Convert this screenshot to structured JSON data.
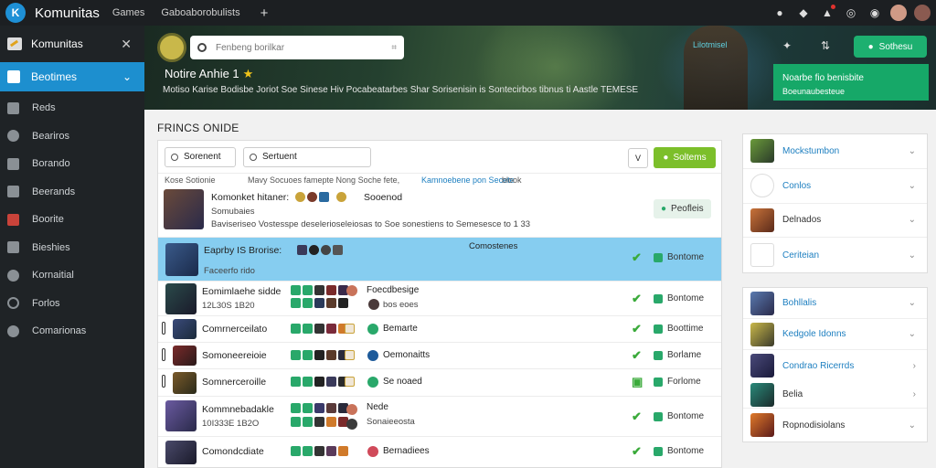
{
  "topbar": {
    "brand": "Komunitas",
    "nav": [
      "Games",
      "Gaboaborobulists"
    ],
    "plus": "+"
  },
  "sidebar": {
    "header": "Komunitas",
    "active": "Beotimes",
    "items": [
      "Reds",
      "Beariros",
      "Borando",
      "Beerands",
      "Boorite",
      "Bieshies",
      "Kornaitial",
      "Forlos",
      "Comarionas"
    ]
  },
  "hero": {
    "search_placeholder": "Fenbeng borilkar",
    "title": "Notire Anhie 1",
    "subtitle": "Motiso Karise Bodisbe Joriot Soe Sinese Hiv Pocabeatarbes Shar Sorisenisin is Sontecirbos tibnus ti Aastle TEMESE",
    "tag": "Lilotmisel",
    "join_button": "Sothesu",
    "promo_line1": "Noarbe fio benisbite",
    "promo_line2": "Boeunaubesteue"
  },
  "main": {
    "section_title": "FRINCS ONIDE",
    "filter1": "Sorenent",
    "filter2": "Sertuent",
    "dropdown": "V",
    "apply": "Soltems",
    "colheaders": [
      "Kose Sotionie",
      "Mavy Socuoes famepte Nong Soche fete,",
      "Kamnoebene pon Secete",
      "blook"
    ],
    "rows": [
      {
        "name": "Komonket hitaner:",
        "meta": "Sooenod",
        "sub1": "Somubaies",
        "sub2": "Baviseriseo Vostesspe deselerioseleiosas to Soe sonestiens to Semesesce to 1 33",
        "action": "Peofleis"
      },
      {
        "name": "Eaprby IS Brorise:",
        "mid": "Comostenes",
        "sub1": "Faceerfo rido",
        "status": "Bontome"
      },
      {
        "name": "Eomimlaehe sidde",
        "sub1": "12L30S 1B20",
        "desc1": "Foecdbesige",
        "desc2": "bos eoes",
        "status": "Bontome"
      },
      {
        "name": "Comrnerceilato",
        "desc1": "Bemarte",
        "status": "Boottime"
      },
      {
        "name": "Somoneereioie",
        "desc1": "Oemonaitts",
        "status": "Borlame"
      },
      {
        "name": "Somnerceroille",
        "desc1": "Se noaed",
        "status": "Forlome"
      },
      {
        "name": "Kommnebadakle",
        "sub1": "10I333E 1B2O",
        "desc1": "Nede",
        "desc2": "Sonaieeosta",
        "status": "Bontome"
      },
      {
        "name": "Comondcdiate",
        "desc1": "Bernadiees",
        "status": "Bontome"
      }
    ]
  },
  "right": {
    "group1": [
      "Mockstumbon",
      "Conlos",
      "Delnados",
      "Ceriteian"
    ],
    "group2": [
      "Bohllalis",
      "Kedgole Idonns",
      "Condrao Ricerrds",
      "Belia",
      "Ropnodisiolans"
    ]
  }
}
